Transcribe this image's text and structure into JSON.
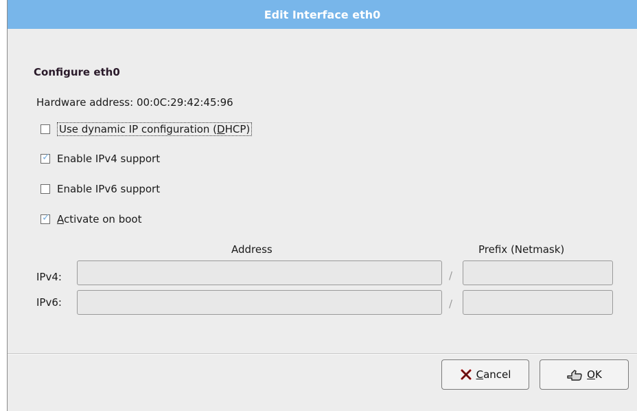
{
  "window": {
    "title": "Edit Interface eth0"
  },
  "section": {
    "title": "Configure eth0"
  },
  "hardware": {
    "label": "Hardware address: 00:0C:29:42:45:96"
  },
  "options": [
    {
      "pre": "Use dynamic IP configuration (",
      "mnemonic": "D",
      "post": "HCP)",
      "checked": false
    },
    {
      "pre": "Enable IPv4 support",
      "mnemonic": "",
      "post": "",
      "checked": true
    },
    {
      "pre": "Enable IPv6 support",
      "mnemonic": "",
      "post": "",
      "checked": false
    },
    {
      "pre": "",
      "mnemonic": "A",
      "post": "ctivate on boot",
      "checked": true
    }
  ],
  "address_table": {
    "headers": {
      "address": "Address",
      "prefix": "Prefix (Netmask)"
    },
    "separator": "/",
    "rows": [
      {
        "label": "IPv4:",
        "address": "",
        "prefix": ""
      },
      {
        "label": "IPv6:",
        "address": "",
        "prefix": ""
      }
    ]
  },
  "buttons": {
    "cancel": {
      "mnemonic": "C",
      "rest": "ancel",
      "icon": "cancel-x-icon"
    },
    "ok": {
      "mnemonic": "O",
      "rest": "K",
      "icon": "ok-hand-icon"
    }
  },
  "colors": {
    "titlebar": "#78b6ea",
    "check": "#7aaedb"
  }
}
